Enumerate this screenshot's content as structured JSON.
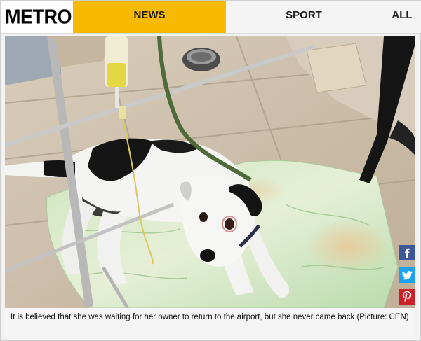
{
  "header": {
    "logo": "METRO",
    "nav": [
      {
        "label": "NEWS",
        "active": true
      },
      {
        "label": "SPORT",
        "active": false
      },
      {
        "label": "ALL",
        "active": false
      }
    ]
  },
  "colors": {
    "accent": "#f8ba00",
    "facebook": "#3b5998",
    "twitter": "#1da1f2",
    "pinterest": "#cb2027"
  },
  "share": {
    "icons": [
      "facebook-icon",
      "twitter-icon",
      "pinterest-icon"
    ]
  },
  "caption": {
    "text": "It is believed that she was waiting for her owner to return to the airport, but she never came back (Picture: CEN)"
  }
}
